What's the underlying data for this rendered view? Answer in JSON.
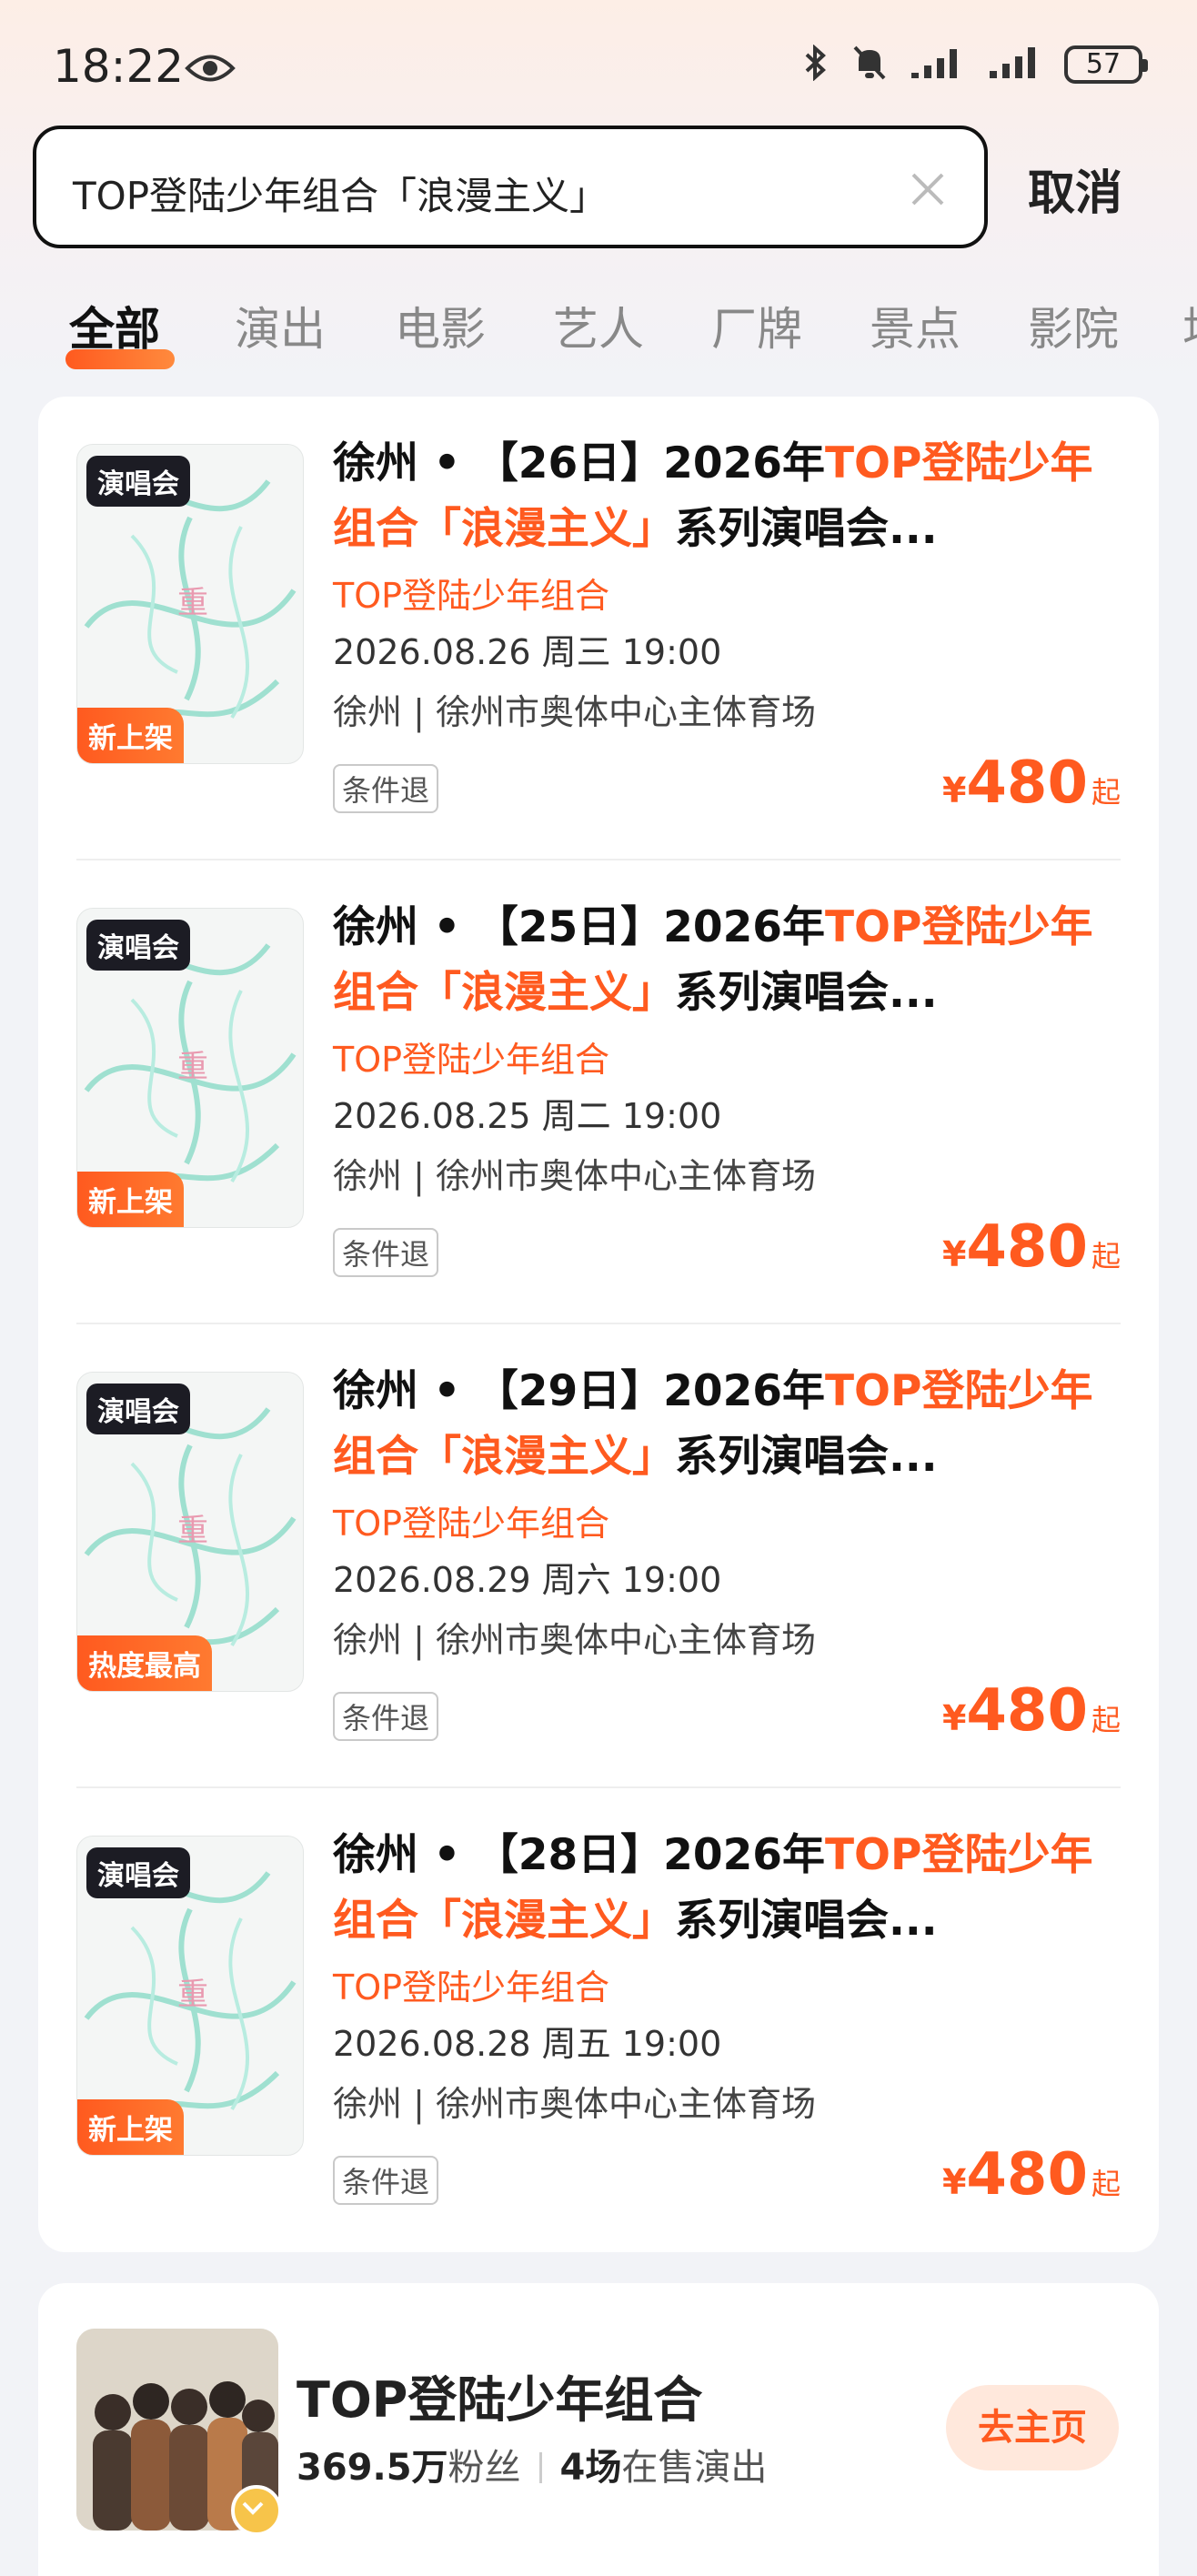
{
  "status_bar": {
    "time": "18:22",
    "battery": "57"
  },
  "search": {
    "query": "TOP登陆少年组合「浪漫主义」",
    "cancel_label": "取消"
  },
  "tabs": [
    "全部",
    "演出",
    "电影",
    "艺人",
    "厂牌",
    "景点",
    "影院",
    "场"
  ],
  "results": [
    {
      "category": "演唱会",
      "tag": "新上架",
      "title_prefix": "徐州 • 【26日】2026年",
      "title_highlight": "TOP登陆少年组合「浪漫主义」",
      "title_suffix": "系列演唱会...",
      "artist": "TOP登陆少年组合",
      "datetime": "2026.08.26 周三 19:00",
      "venue": "徐州 | 徐州市奥体中心主体育场",
      "refund": "条件退",
      "price_symbol": "¥",
      "price": "480",
      "price_suffix": "起"
    },
    {
      "category": "演唱会",
      "tag": "新上架",
      "title_prefix": "徐州 • 【25日】2026年",
      "title_highlight": "TOP登陆少年组合「浪漫主义」",
      "title_suffix": "系列演唱会...",
      "artist": "TOP登陆少年组合",
      "datetime": "2026.08.25 周二 19:00",
      "venue": "徐州 | 徐州市奥体中心主体育场",
      "refund": "条件退",
      "price_symbol": "¥",
      "price": "480",
      "price_suffix": "起"
    },
    {
      "category": "演唱会",
      "tag": "热度最高",
      "title_prefix": "徐州 • 【29日】2026年",
      "title_highlight": "TOP登陆少年组合「浪漫主义」",
      "title_suffix": "系列演唱会...",
      "artist": "TOP登陆少年组合",
      "datetime": "2026.08.29 周六 19:00",
      "venue": "徐州 | 徐州市奥体中心主体育场",
      "refund": "条件退",
      "price_symbol": "¥",
      "price": "480",
      "price_suffix": "起"
    },
    {
      "category": "演唱会",
      "tag": "新上架",
      "title_prefix": "徐州 • 【28日】2026年",
      "title_highlight": "TOP登陆少年组合「浪漫主义」",
      "title_suffix": "系列演唱会...",
      "artist": "TOP登陆少年组合",
      "datetime": "2026.08.28 周五 19:00",
      "venue": "徐州 | 徐州市奥体中心主体育场",
      "refund": "条件退",
      "price_symbol": "¥",
      "price": "480",
      "price_suffix": "起"
    }
  ],
  "artist_card": {
    "name": "TOP登陆少年组合",
    "fans_count": "369.5万",
    "fans_label": "粉丝",
    "shows_count": "4场",
    "shows_label": "在售演出",
    "button_label": "去主页"
  },
  "colors": {
    "accent": "#ff5a1f",
    "badge_dark": "#1c1c24",
    "page_bg": "#f2f3f7"
  }
}
